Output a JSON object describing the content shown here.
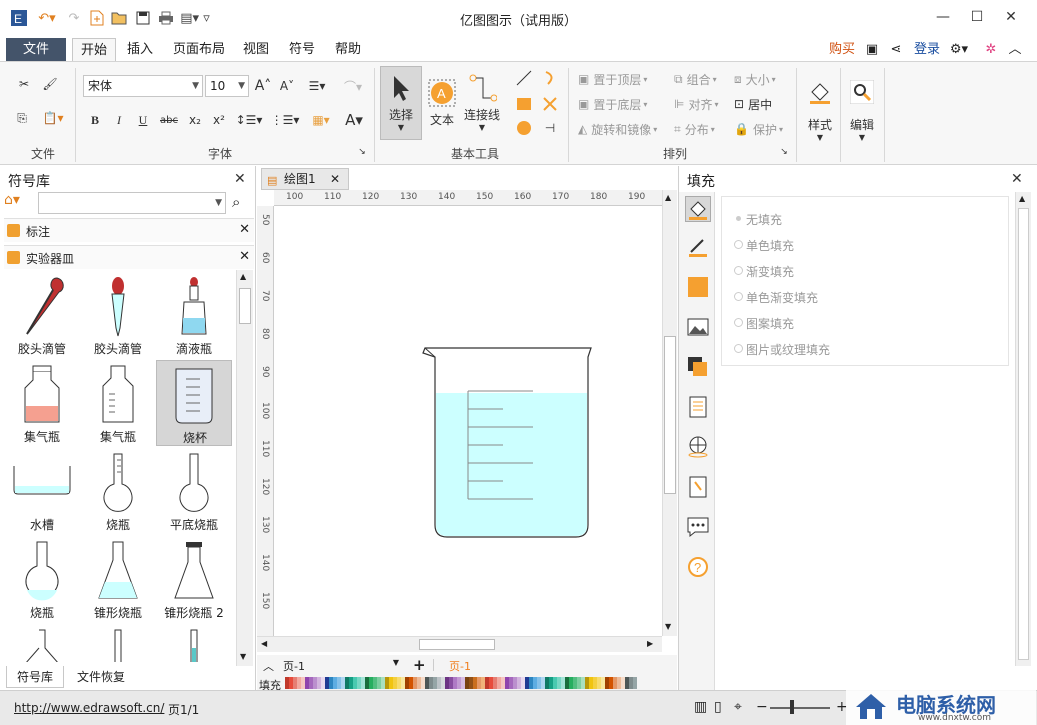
{
  "window": {
    "title": "亿图图示（试用版）"
  },
  "menu": {
    "file": "文件",
    "tabs": [
      "开始",
      "插入",
      "页面布局",
      "视图",
      "符号",
      "帮助"
    ],
    "active_tab": "开始",
    "buy": "购买",
    "login": "登录"
  },
  "ribbon": {
    "groups": {
      "file": "文件",
      "font": "字体",
      "basic_tools": "基本工具",
      "arrange": "排列"
    },
    "font_name": "宋体",
    "font_size": "10",
    "tools": {
      "select": "选择",
      "text": "文本",
      "connector": "连接线"
    },
    "arrange": {
      "bring_front": "置于顶层",
      "send_back": "置于底层",
      "rotate_mirror": "旋转和镜像",
      "group": "组合",
      "align": "对齐",
      "distribute": "分布",
      "size": "大小",
      "center": "居中",
      "protect": "保护"
    },
    "style": "样式",
    "edit": "编辑"
  },
  "left_panel": {
    "title": "符号库",
    "libraries": [
      "标注",
      "实验器皿"
    ],
    "symbols": [
      "胶头滴管",
      "胶头滴管",
      "滴液瓶",
      "集气瓶",
      "集气瓶",
      "烧杯",
      "水槽",
      "烧瓶",
      "平底烧瓶",
      "烧瓶",
      "锥形烧瓶",
      "锥形烧瓶 2"
    ],
    "selected_symbol": "烧杯",
    "bottom_tabs": [
      "符号库",
      "文件恢复"
    ]
  },
  "canvas": {
    "tab": "绘图1",
    "h_ruler": [
      "100",
      "110",
      "120",
      "130",
      "140",
      "150",
      "160",
      "170",
      "180",
      "190"
    ],
    "v_ruler": [
      "50",
      "60",
      "70",
      "80",
      "90",
      "100",
      "110",
      "120",
      "130",
      "140",
      "150"
    ],
    "page_dropdown": "页-1",
    "page_active": "页-1",
    "fill_label": "填充"
  },
  "right_panel": {
    "title": "填充",
    "options": [
      "无填充",
      "单色填充",
      "渐变填充",
      "单色渐变填充",
      "图案填充",
      "图片或纹理填充"
    ]
  },
  "status": {
    "url": "http://www.edrawsoft.cn/",
    "page": "页1/1",
    "watermark": "电脑系统网",
    "watermark_sub": "www.dnxtw.com"
  },
  "colors": {
    "accent_orange": "#f5a030",
    "file_tab": "#44546a",
    "beaker_liquid": "#ccffff"
  }
}
